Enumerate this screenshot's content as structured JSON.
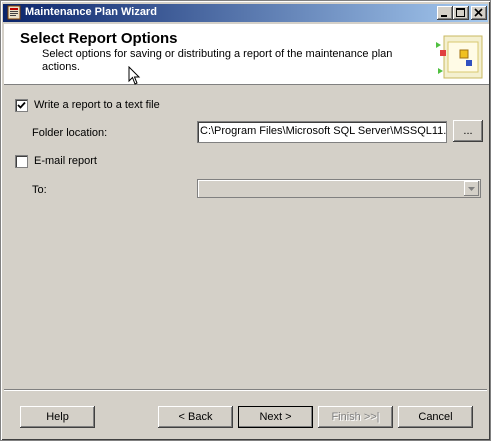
{
  "window": {
    "title": "Maintenance Plan Wizard",
    "title_icon": "wizard-app-icon"
  },
  "header": {
    "title": "Select Report Options",
    "description": "Select options for saving or distributing a report of the maintenance plan actions."
  },
  "options": {
    "write_report": {
      "label": "Write a report to a text file",
      "checked": true
    },
    "folder_location": {
      "label": "Folder location:",
      "value": "C:\\Program Files\\Microsoft SQL Server\\MSSQL11.",
      "browse_label": "..."
    },
    "email_report": {
      "label": "E-mail report",
      "checked": false
    },
    "to": {
      "label": "To:",
      "value": ""
    }
  },
  "footer": {
    "help": "Help",
    "back": "< Back",
    "next": "Next >",
    "finish": "Finish >>|",
    "cancel": "Cancel"
  },
  "colors": {
    "title_start": "#0a246a",
    "title_end": "#a6caf0",
    "face": "#d4d0c8"
  }
}
